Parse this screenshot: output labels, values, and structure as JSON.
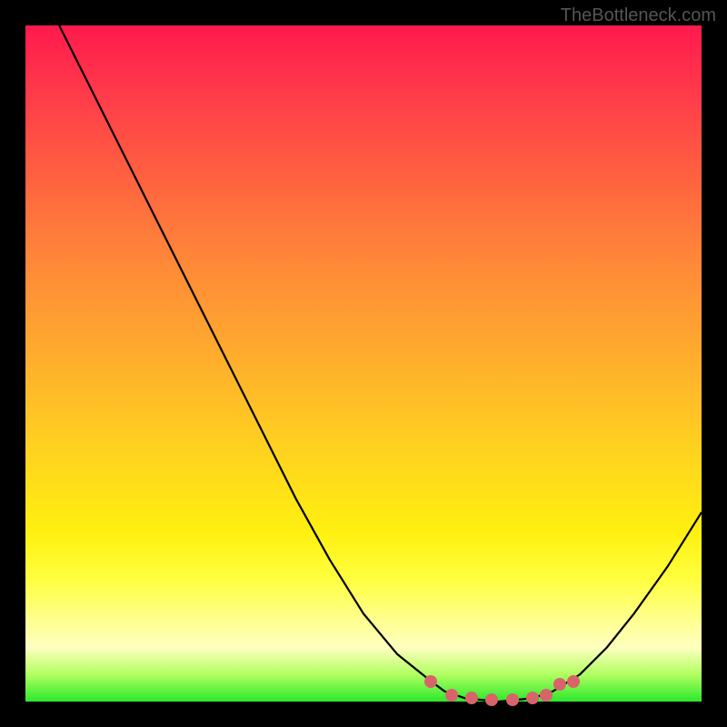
{
  "watermark": "TheBottleneck.com",
  "chart_data": {
    "type": "line",
    "title": "",
    "xlabel": "",
    "ylabel": "",
    "xlim": [
      0,
      100
    ],
    "ylim": [
      0,
      100
    ],
    "grid": false,
    "description": "Bottleneck curve: single black curve descending from top-left to a minimum near x≈70 then rising again. Gradient background (red→yellow→green) encodes bottleneck severity. Pink markers cluster at the trough.",
    "series": [
      {
        "name": "bottleneck-curve",
        "data": [
          {
            "x": 5,
            "y": 100
          },
          {
            "x": 10,
            "y": 90
          },
          {
            "x": 15,
            "y": 80
          },
          {
            "x": 20,
            "y": 70
          },
          {
            "x": 25,
            "y": 60
          },
          {
            "x": 30,
            "y": 50
          },
          {
            "x": 35,
            "y": 40
          },
          {
            "x": 40,
            "y": 30
          },
          {
            "x": 45,
            "y": 21
          },
          {
            "x": 50,
            "y": 13
          },
          {
            "x": 55,
            "y": 7
          },
          {
            "x": 60,
            "y": 3
          },
          {
            "x": 62,
            "y": 1.5
          },
          {
            "x": 65,
            "y": 0.5
          },
          {
            "x": 70,
            "y": 0
          },
          {
            "x": 75,
            "y": 0.5
          },
          {
            "x": 78,
            "y": 1.5
          },
          {
            "x": 82,
            "y": 4
          },
          {
            "x": 86,
            "y": 8
          },
          {
            "x": 90,
            "y": 13
          },
          {
            "x": 95,
            "y": 20
          },
          {
            "x": 100,
            "y": 28
          }
        ]
      }
    ],
    "markers": [
      {
        "x": 60,
        "y": 3
      },
      {
        "x": 63,
        "y": 1
      },
      {
        "x": 66,
        "y": 0.5
      },
      {
        "x": 69,
        "y": 0.3
      },
      {
        "x": 72,
        "y": 0.3
      },
      {
        "x": 75,
        "y": 0.5
      },
      {
        "x": 77,
        "y": 1
      },
      {
        "x": 79,
        "y": 2.5
      },
      {
        "x": 81,
        "y": 3
      }
    ],
    "gradient_stops": [
      {
        "pct": 0,
        "color": "#ff1a4d",
        "meaning": "severe-bottleneck"
      },
      {
        "pct": 50,
        "color": "#ffaa2e",
        "meaning": "moderate"
      },
      {
        "pct": 80,
        "color": "#ffff40",
        "meaning": "low"
      },
      {
        "pct": 100,
        "color": "#2ce82c",
        "meaning": "no-bottleneck"
      }
    ]
  }
}
